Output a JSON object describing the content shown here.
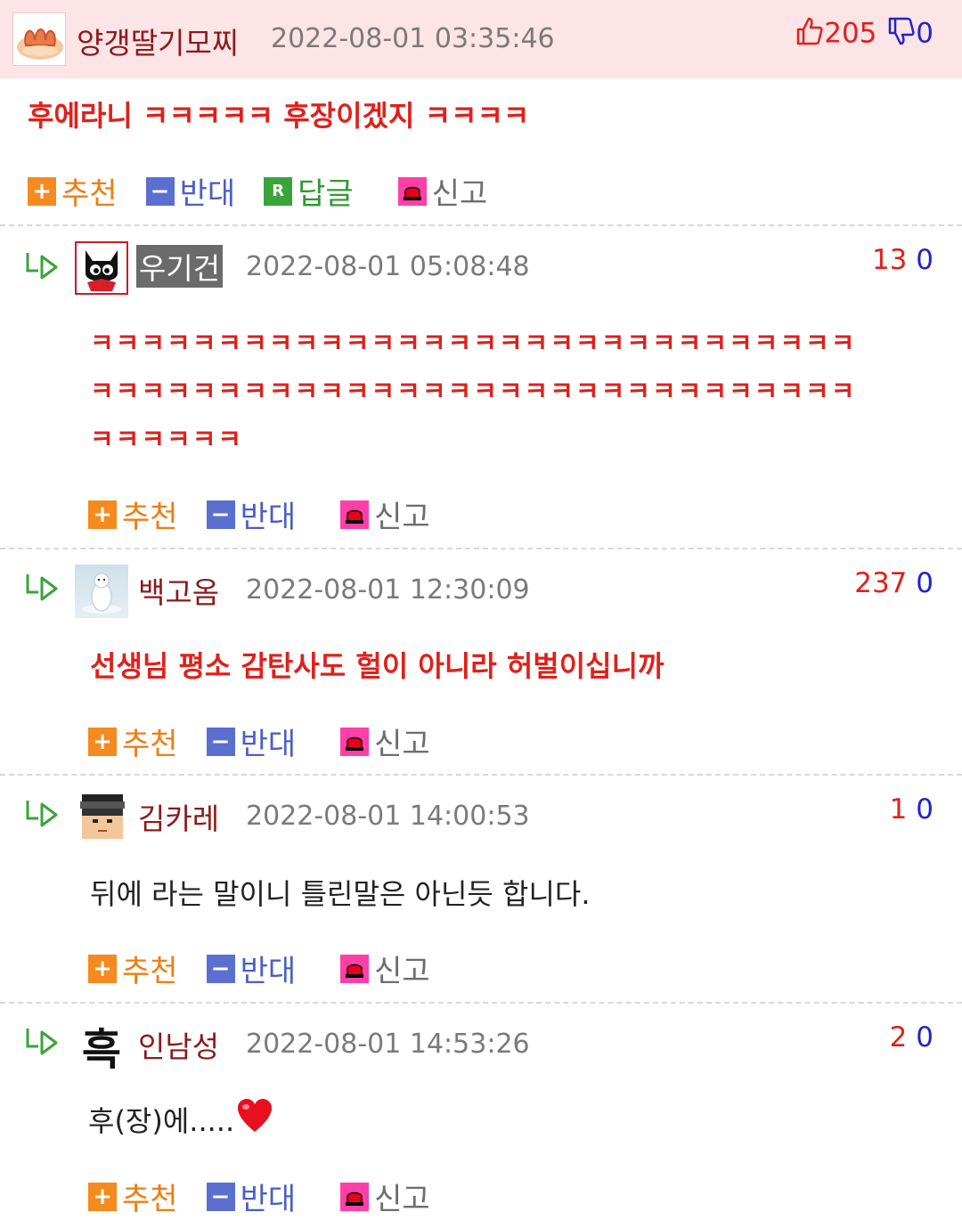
{
  "actions": {
    "recommend": "추천",
    "oppose": "반대",
    "reply": "답글",
    "report": "신고"
  },
  "comments": [
    {
      "nickname": "양갱딸기모찌",
      "date": "2022-08-01 03:35:46",
      "up": "205",
      "down": "0",
      "text": "후에라니 ㅋㅋㅋㅋㅋ 후장이겠지 ㅋㅋㅋㅋ"
    },
    {
      "nickname": "우기건",
      "date": "2022-08-01 05:08:48",
      "up": "13",
      "down": "0",
      "lines": [
        "ㅋㅋㅋㅋㅋㅋㅋㅋㅋㅋㅋㅋㅋㅋㅋㅋㅋㅋㅋㅋㅋㅋㅋㅋㅋㅋㅋㅋㅋㅋ",
        "ㅋㅋㅋㅋㅋㅋㅋㅋㅋㅋㅋㅋㅋㅋㅋㅋㅋㅋㅋㅋㅋㅋㅋㅋㅋㅋㅋㅋㅋㅋ",
        "ㅋㅋㅋㅋㅋㅋ"
      ]
    },
    {
      "nickname": "백고옴",
      "date": "2022-08-01 12:30:09",
      "up": "237",
      "down": "0",
      "text": "선생님 평소 감탄사도 헐이 아니라 허벌이십니까"
    },
    {
      "nickname": "김카레",
      "date": "2022-08-01 14:00:53",
      "up": "1",
      "down": "0",
      "text": "뒤에 라는 말이니 틀린말은 아닌듯 합니다."
    },
    {
      "nickname": "인남성",
      "avatar_text": "흑",
      "date": "2022-08-01 14:53:26",
      "up": "2",
      "down": "0",
      "text": "후(장)에....."
    }
  ]
}
